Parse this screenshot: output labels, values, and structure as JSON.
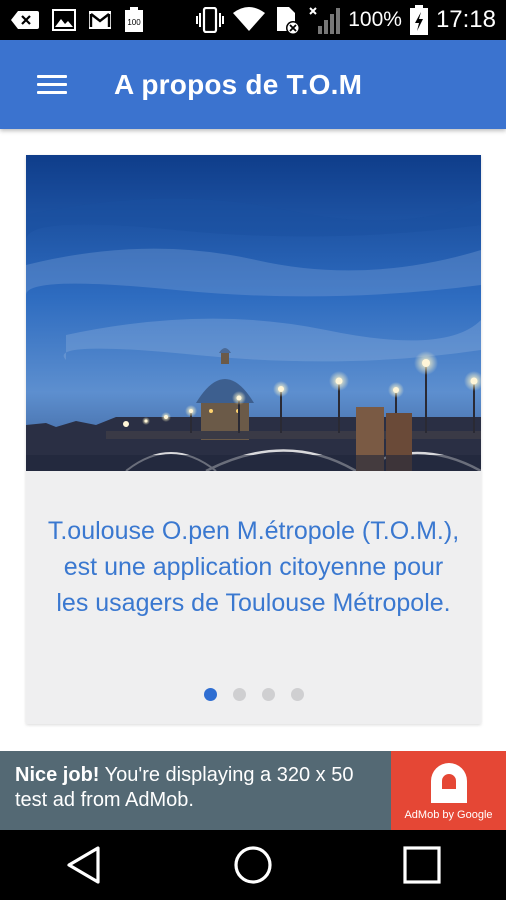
{
  "status_bar": {
    "battery_percent": "100%",
    "time": "17:18",
    "icons": [
      "back-notification-icon",
      "image-icon",
      "gmail-icon",
      "battery-100-icon",
      "vibrate-icon",
      "wifi-icon",
      "sim-none-icon",
      "signal-icon",
      "battery-charging-icon"
    ]
  },
  "app_bar": {
    "title": "A propos de T.O.M",
    "menu_icon": "hamburger-menu-icon",
    "color": "#3b73cf"
  },
  "carousel": {
    "image_description_icon": "bridge-night-photo",
    "description": "T.oulouse O.pen M.étropole (T.O.M.), est une application citoyenne pour les usagers de Toulouse Métropole.",
    "page_count": 4,
    "current_page": 1,
    "text_color": "#3a78d0"
  },
  "ad": {
    "bold_text": "Nice job!",
    "text": " You're displaying a 320 x 50 test ad from AdMob.",
    "logo_label": "AdMob by Google",
    "background": "#546974",
    "logo_background": "#e54735"
  },
  "nav_bar": {
    "buttons": [
      "back-icon",
      "home-icon",
      "recents-icon"
    ]
  }
}
